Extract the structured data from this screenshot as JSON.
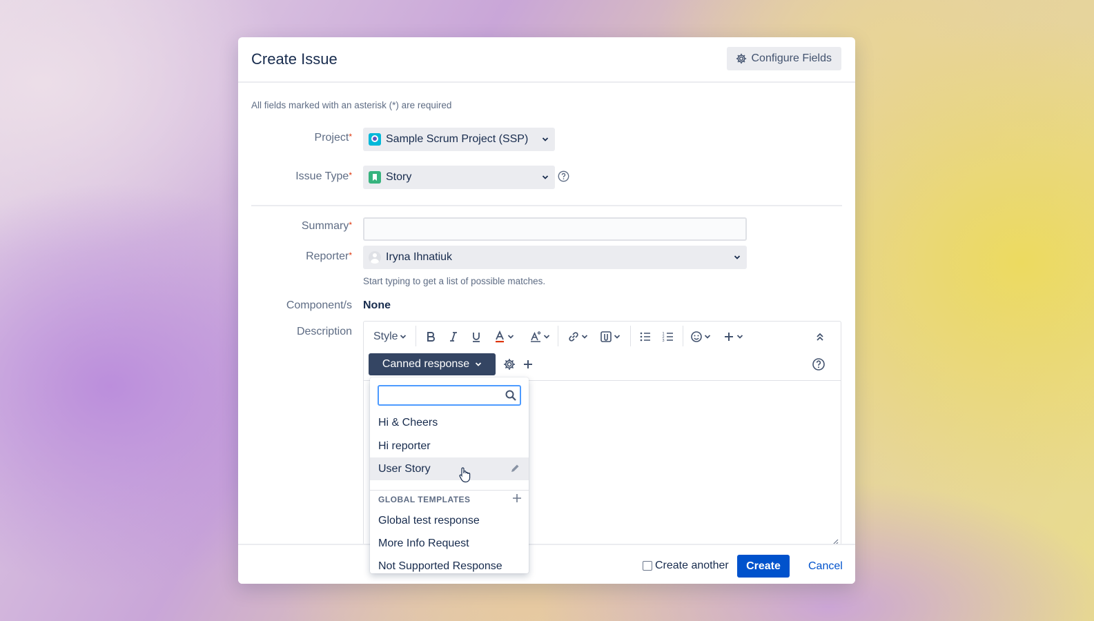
{
  "dialog": {
    "title": "Create Issue",
    "configure_fields_label": "Configure Fields",
    "required_note": "All fields marked with an asterisk (*) are required"
  },
  "fields": {
    "project": {
      "label": "Project",
      "required_mark": "*",
      "value": "Sample Scrum Project (SSP)",
      "icon": "project-avatar-icon"
    },
    "issue_type": {
      "label": "Issue Type",
      "required_mark": "*",
      "value": "Story",
      "icon": "story-icon"
    },
    "summary": {
      "label": "Summary",
      "required_mark": "*",
      "value": ""
    },
    "reporter": {
      "label": "Reporter",
      "required_mark": "*",
      "value": "Iryna Ihnatiuk",
      "hint": "Start typing to get a list of possible matches."
    },
    "components": {
      "label": "Component/s",
      "value": "None"
    },
    "description": {
      "label": "Description"
    }
  },
  "editor": {
    "style_label": "Style",
    "canned_response_label": "Canned response"
  },
  "canned_menu": {
    "search_value": "",
    "personal_items": [
      "Hi & Cheers",
      "Hi reporter",
      "User Story"
    ],
    "hovered_item": "User Story",
    "group_title": "GLOBAL TEMPLATES",
    "global_items": [
      "Global test response",
      "More Info Request",
      "Not Supported Response"
    ]
  },
  "footer": {
    "create_another_label": "Create another",
    "create_another_checked": false,
    "create_label": "Create",
    "cancel_label": "Cancel"
  },
  "colors": {
    "primary": "#0052cc",
    "canned_button": "#344563",
    "required": "#de350b",
    "story_green": "#36b37e"
  }
}
